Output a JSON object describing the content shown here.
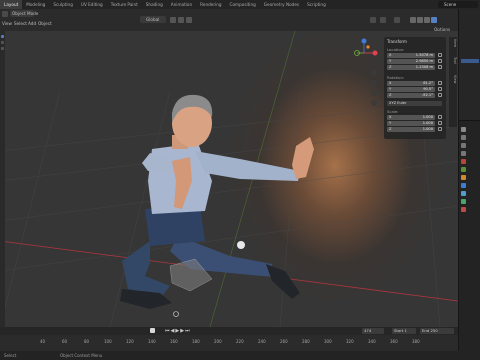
{
  "workspace_tabs": [
    "Layout",
    "Modeling",
    "Sculpting",
    "UV Editing",
    "Texture Paint",
    "Shading",
    "Animation",
    "Rendering",
    "Compositing",
    "Geometry Nodes",
    "Scripting"
  ],
  "scene_name": "Scene",
  "viewport_header": {
    "menu": [
      "View",
      "Select",
      "Add",
      "Object"
    ],
    "mode_label": "Object Mode",
    "orientation_label": "Global",
    "options_label": "Options"
  },
  "n_panel": {
    "title": "Transform",
    "location_label": "Location:",
    "location": {
      "x": "1.5078 m",
      "y": "2.9850 m",
      "z": "1.2308 m"
    },
    "rotation_label": "Rotation:",
    "rotation": {
      "x": "61.2°",
      "y": "90.5°",
      "z": "-92.1°"
    },
    "rotation_mode": "XYZ Euler",
    "scale_label": "Scale:",
    "scale": {
      "x": "1.000",
      "y": "1.000",
      "z": "1.000"
    },
    "axis_labels": [
      "X",
      "Y",
      "Z"
    ],
    "tabs": [
      "Item",
      "Tool",
      "View"
    ]
  },
  "timeline": {
    "current_frame": "474",
    "start_label": "Start",
    "start_value": "1",
    "end_label": "End",
    "end_value": "250",
    "ticks": [
      "40",
      "60",
      "80",
      "100",
      "120",
      "140",
      "160",
      "180",
      "200",
      "220",
      "240",
      "260",
      "280",
      "300",
      "320",
      "340",
      "360",
      "380"
    ]
  },
  "status_bar": {
    "hint_1": "Select",
    "hint_2": "Object Context Menu"
  },
  "colors": {
    "accent_selected": "#f08a24",
    "axis_x": "#e2414f",
    "axis_y": "#6eb43c",
    "axis_z": "#3d7dd8"
  }
}
